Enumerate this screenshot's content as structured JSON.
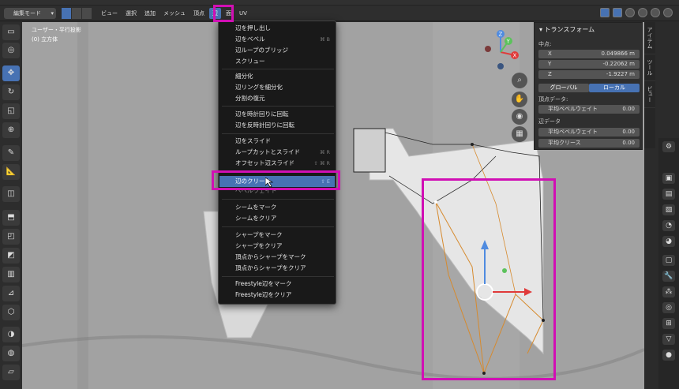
{
  "header": {
    "mode": "編集モード",
    "menu": [
      "ビュー",
      "選択",
      "追加",
      "メッシュ",
      "頂点",
      "辺",
      "面",
      "UV"
    ]
  },
  "viewport": {
    "view_name": "ユーザー・平行投影",
    "object_name": "(0) 立方体"
  },
  "sidebar_tabs": [
    "アイテム",
    "ツール",
    "ビュー"
  ],
  "transform_panel": {
    "title": "トランスフォーム",
    "median_label": "中点:",
    "fields": [
      {
        "axis": "X",
        "value": "0.049866 m"
      },
      {
        "axis": "Y",
        "value": "-0.22062 m"
      },
      {
        "axis": "Z",
        "value": "-1.9227 m"
      }
    ],
    "global_label": "グローバル",
    "local_label": "ローカル",
    "vertex_data_label": "頂点データ:",
    "vertex_bevel_label": "平均ベベルウェイト",
    "vertex_bevel_value": "0.00",
    "edge_data_label": "辺データ",
    "edge_bevel_label": "平均ベベルウェイト",
    "edge_bevel_value": "0.00",
    "edge_crease_label": "平均クリース",
    "edge_crease_value": "0.00"
  },
  "edge_menu": {
    "groups": [
      [
        {
          "label": "辺を押し出し",
          "shortcut": ""
        },
        {
          "label": "辺をベベル",
          "shortcut": "⌘ B"
        },
        {
          "label": "辺ループのブリッジ",
          "shortcut": ""
        },
        {
          "label": "スクリュー",
          "shortcut": ""
        }
      ],
      [
        {
          "label": "細分化",
          "shortcut": ""
        },
        {
          "label": "辺リングを細分化",
          "shortcut": ""
        },
        {
          "label": "分割の復元",
          "shortcut": ""
        }
      ],
      [
        {
          "label": "辺を時計回りに回転",
          "shortcut": ""
        },
        {
          "label": "辺を反時計回りに回転",
          "shortcut": ""
        }
      ],
      [
        {
          "label": "辺をスライド",
          "shortcut": ""
        },
        {
          "label": "ループカットとスライド",
          "shortcut": "⌘ R"
        },
        {
          "label": "オフセット辺スライド",
          "shortcut": "⇧ ⌘ R"
        }
      ],
      [
        {
          "label": "辺のクリース",
          "shortcut": "⇧ E"
        },
        {
          "label": "ベベルウェイト",
          "shortcut": ""
        }
      ],
      [
        {
          "label": "シームをマーク",
          "shortcut": ""
        },
        {
          "label": "シームをクリア",
          "shortcut": ""
        }
      ],
      [
        {
          "label": "シャープをマーク",
          "shortcut": ""
        },
        {
          "label": "シャープをクリア",
          "shortcut": ""
        },
        {
          "label": "頂点からシャープをマーク",
          "shortcut": ""
        },
        {
          "label": "頂点からシャープをクリア",
          "shortcut": ""
        }
      ],
      [
        {
          "label": "Freestyle辺をマーク",
          "shortcut": ""
        },
        {
          "label": "Freestyle辺をクリア",
          "shortcut": ""
        }
      ]
    ],
    "highlighted": "辺のクリース"
  },
  "gizmo": {
    "x_label": "X",
    "y_label": "Y",
    "z_label": "Z"
  },
  "colors": {
    "accent": "#4772b3",
    "highlight_box": "#d10fb4",
    "edge_orange": "#d68a2e"
  }
}
